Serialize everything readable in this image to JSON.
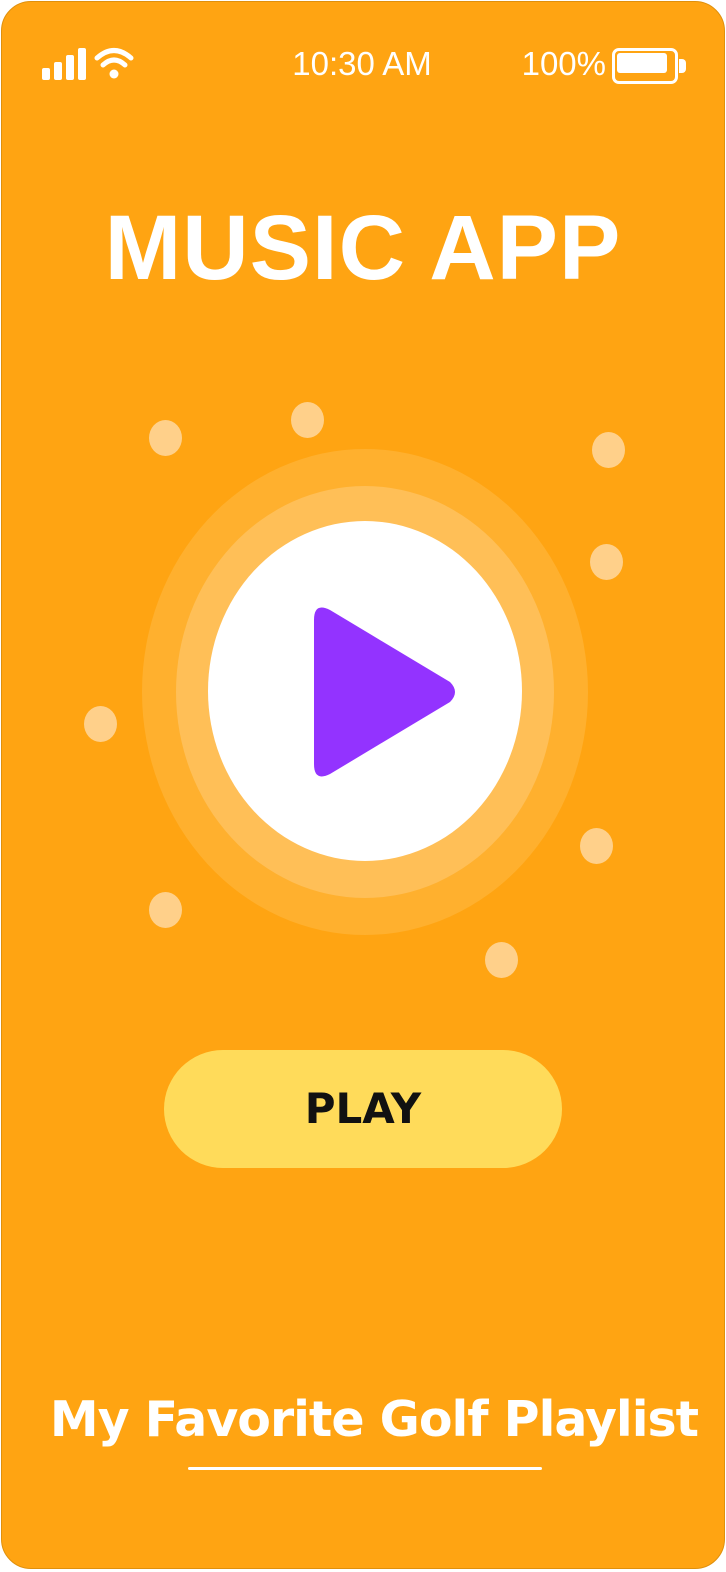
{
  "status_bar": {
    "time": "10:30 AM",
    "battery_percent": "100%",
    "signal_icon": "cellular-signal-icon",
    "wifi_icon": "wifi-icon",
    "battery_icon": "battery-icon",
    "battery_level": 1.0
  },
  "app": {
    "title": "MUSIC APP"
  },
  "player": {
    "play_icon": "play-icon",
    "play_label": "PLAY"
  },
  "playlist": {
    "title": "My Favorite Golf Playlist"
  },
  "colors": {
    "background": "#FFA412",
    "ring_outer": "#FFB02E",
    "ring_mid": "#FFBF57",
    "ring_inner": "#FFFFFF",
    "dots": "#FFD08A",
    "play_icon": "#9333FF",
    "play_button": "#FFDB5A",
    "text_light": "#FFFFFF",
    "text_dark": "#111111"
  }
}
